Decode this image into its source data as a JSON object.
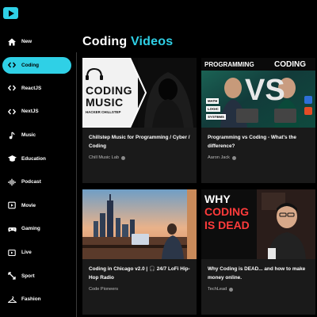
{
  "sidebar": {
    "items": [
      {
        "label": "New",
        "icon": "home-icon"
      },
      {
        "label": "Coding",
        "icon": "code-icon",
        "active": true
      },
      {
        "label": "ReactJS",
        "icon": "code-icon"
      },
      {
        "label": "NextJS",
        "icon": "code-icon"
      },
      {
        "label": "Music",
        "icon": "music-note-icon"
      },
      {
        "label": "Education",
        "icon": "graduation-cap-icon"
      },
      {
        "label": "Podcast",
        "icon": "podcast-icon"
      },
      {
        "label": "Movie",
        "icon": "movie-icon"
      },
      {
        "label": "Gaming",
        "icon": "gamepad-icon"
      },
      {
        "label": "Live",
        "icon": "live-icon"
      },
      {
        "label": "Sport",
        "icon": "sport-icon"
      },
      {
        "label": "Fashion",
        "icon": "fashion-icon"
      }
    ]
  },
  "page": {
    "title_prefix": "Coding",
    "title_accent": "Videos",
    "accent_color": "#2fd0e6"
  },
  "videos": [
    {
      "title": "Chillstep Music for Programming / Cyber / Coding",
      "channel": "Chill Music Lab",
      "thumb_text_1": "CODING",
      "thumb_text_2": "MUSIC",
      "thumb_text_3": "HACKER CHILLSTEP"
    },
    {
      "title": "Programming vs Coding - What's the difference?",
      "channel": "Aaron Jack",
      "thumb_text_1": "PROGRAMMING",
      "thumb_text_2": "CODING",
      "thumb_text_3": "VS",
      "thumb_text_4": "MATH",
      "thumb_text_5": "LOGIC",
      "thumb_text_6": "SYSTEMS"
    },
    {
      "title": "Coding in Chicago v2.0 | 🎧 24/7 LoFi Hip-Hop Radio",
      "channel": "Code Pioneers"
    },
    {
      "title": "Why Coding is DEAD... and how to make money online.",
      "channel": "TechLead",
      "thumb_text_1": "WHY",
      "thumb_text_2": "CODING",
      "thumb_text_3": "IS DEAD"
    }
  ]
}
